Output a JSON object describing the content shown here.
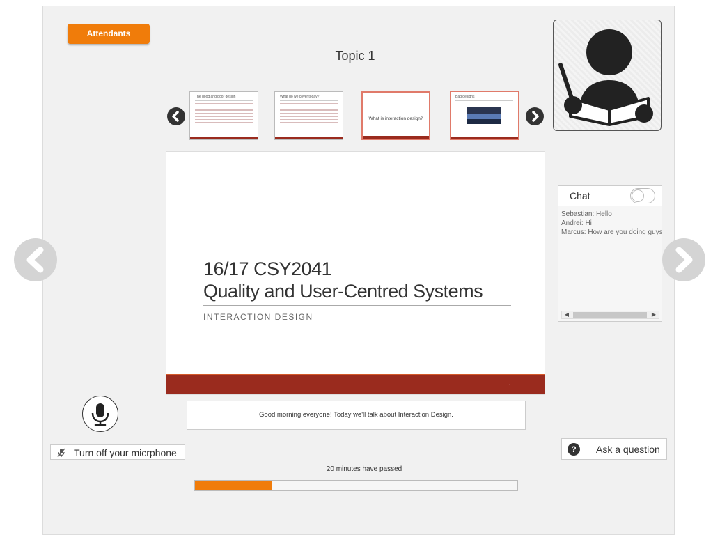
{
  "header": {
    "attendants_label": "Attendants",
    "topic_title": "Topic 1"
  },
  "presenter": {
    "icon": "presenter-reading-icon"
  },
  "thumbnails": [
    {
      "title": "The good and poor design",
      "layout": "bullets"
    },
    {
      "title": "What do we cover today?",
      "layout": "bullets"
    },
    {
      "title": "What is interaction design?",
      "layout": "title",
      "active": true
    },
    {
      "title": "Bad designs",
      "layout": "image"
    }
  ],
  "slide": {
    "title_line1": "16/17 CSY2041",
    "title_line2": "Quality and User-Centred Systems",
    "subtitle": "INTERACTION DESIGN",
    "page_number": "1"
  },
  "caption": "Good morning everyone! Today we'll talk about Interaction Design.",
  "microphone": {
    "toggle_label": "Turn off your micrphone",
    "icon": "microphone-icon"
  },
  "progress": {
    "label": "20 minutes have passed",
    "fraction": 0.24
  },
  "chat": {
    "title": "Chat",
    "enabled": false,
    "messages": [
      "Sebastian: Hello",
      "Andrei: Hi",
      "Marcus: How are you doing guys?"
    ]
  },
  "ask": {
    "label": "Ask a question",
    "icon": "question-icon"
  },
  "colors": {
    "accent": "#f07c0a",
    "slide_footer": "#9a2b1e",
    "panel_bg": "#f1f1f1"
  }
}
